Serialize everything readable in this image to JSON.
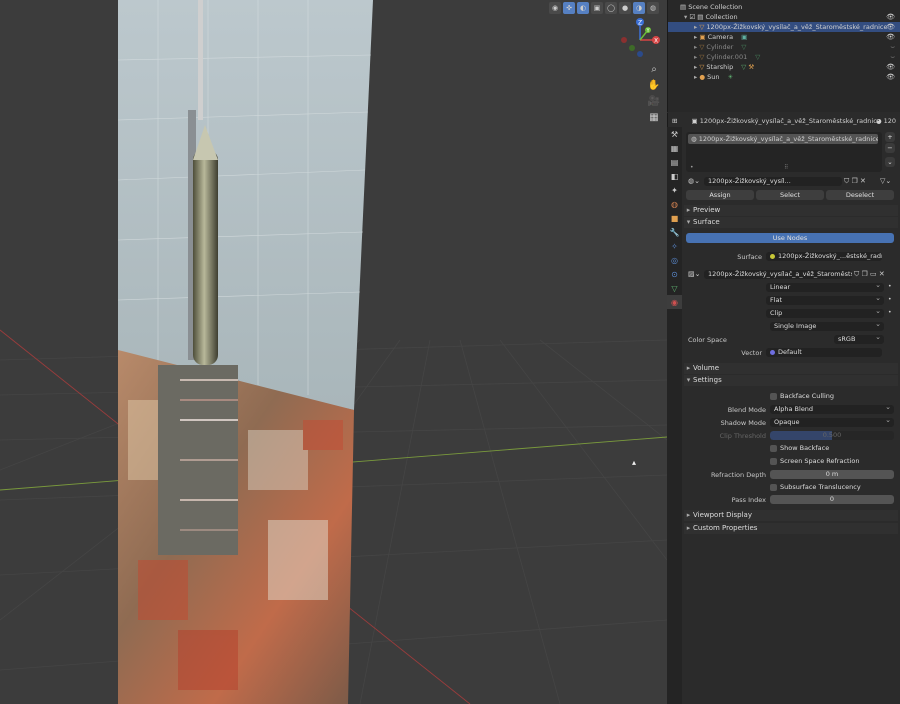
{
  "outliner": {
    "collection_root": "Scene Collection",
    "collection": "Collection",
    "items": [
      {
        "label": "1200px-Žižkovský_vysílač_a_věž_Staroměstské_radnice",
        "selected": true
      },
      {
        "label": "Camera"
      },
      {
        "label": "Cylinder"
      },
      {
        "label": "Cylinder.001"
      },
      {
        "label": "Starship"
      },
      {
        "label": "Sun"
      }
    ]
  },
  "props": {
    "header_object": "1200px-Žižkovský_vysílač_a_věž_Staroměstské_radnice",
    "header_right": "120",
    "material_slot": "1200px-Žižkovský_vysílač_a_věž_Staroměstské_radnice",
    "material_name": "1200px-Žižkovský_vysíl...",
    "assign": "Assign",
    "select": "Select",
    "deselect": "Deselect",
    "preview": "Preview",
    "surface_header": "Surface",
    "use_nodes": "Use Nodes",
    "surface_label": "Surface",
    "surface_value": "1200px-Žižkovský_...ěstské_radnice.jp",
    "image_name": "1200px-Žižkovský_vysílač_a_věž_Staroměstské_ra...",
    "interpolation": "Linear",
    "projection": "Flat",
    "extension": "Clip",
    "source": "Single Image",
    "color_space_label": "Color Space",
    "color_space": "sRGB",
    "vector_label": "Vector",
    "vector_value": "Default",
    "volume": "Volume",
    "settings": "Settings",
    "backface_culling": "Backface Culling",
    "blend_mode_label": "Blend Mode",
    "blend_mode": "Alpha Blend",
    "shadow_mode_label": "Shadow Mode",
    "shadow_mode": "Opaque",
    "clip_threshold_label": "Clip Threshold",
    "clip_threshold": "0.500",
    "show_backface": "Show Backface",
    "screen_space_refraction": "Screen Space Refraction",
    "refraction_depth_label": "Refraction Depth",
    "refraction_depth": "0 m",
    "subsurface_translucency": "Subsurface Translucency",
    "pass_index_label": "Pass Index",
    "pass_index": "0",
    "viewport_display": "Viewport Display",
    "custom_properties": "Custom Properties"
  },
  "gizmo": {
    "z": "Z",
    "y": "Y",
    "x": "X"
  }
}
